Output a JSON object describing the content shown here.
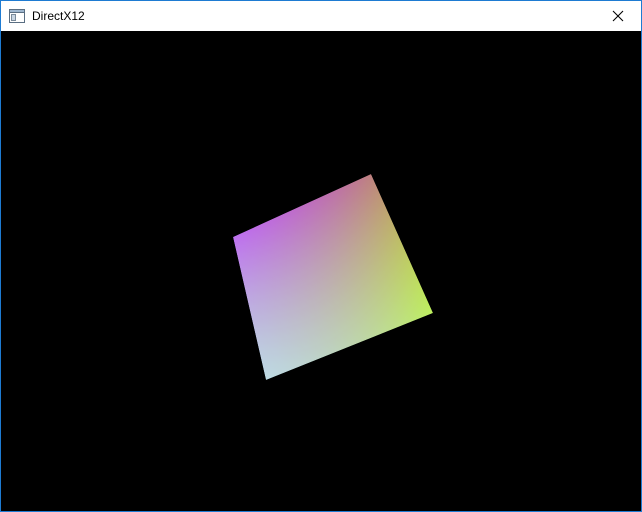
{
  "window": {
    "title": "DirectX12",
    "app_icon": "window-app-icon",
    "close_icon": "close-icon"
  },
  "scene": {
    "background_color": "#000000",
    "object": "rotated-color-quad",
    "vertex_colors": {
      "top_left": "#0000ff",
      "top_right": "#ff0000",
      "bottom_right": "#00ff00",
      "bottom_left": "#ffffff"
    }
  }
}
